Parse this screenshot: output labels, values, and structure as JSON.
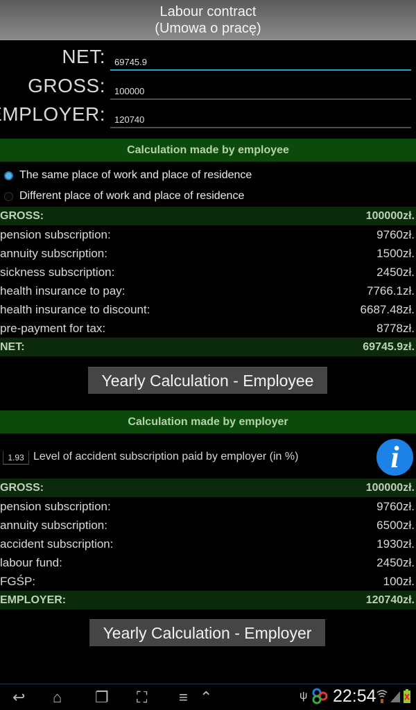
{
  "title": {
    "line1": "Labour contract",
    "line2": "(Umowa o pracę)"
  },
  "fields": {
    "net": {
      "label": "NET:",
      "value": "69745.9"
    },
    "gross": {
      "label": "GROSS:",
      "value": "100000"
    },
    "employer": {
      "label": "EMPLOYER:",
      "value": "120740"
    }
  },
  "employee_section": {
    "header": "Calculation made by employee",
    "radio_options": [
      {
        "label": "The same place of work and place of residence",
        "selected": true
      },
      {
        "label": "Different place of work and place of residence",
        "selected": false
      }
    ],
    "gross": {
      "label": "GROSS:",
      "value": "100000zł."
    },
    "rows": [
      {
        "label": "pension subscription:",
        "value": "9760zł."
      },
      {
        "label": "annuity subscription:",
        "value": "1500zł."
      },
      {
        "label": "sickness subscription:",
        "value": "2450zł."
      },
      {
        "label": "health insurance to pay:",
        "value": "7766.1zł."
      },
      {
        "label": "health insurance to discount:",
        "value": "6687.48zł."
      },
      {
        "label": "pre-payment for tax:",
        "value": "8778zł."
      }
    ],
    "net": {
      "label": "NET:",
      "value": "69745.9zł."
    },
    "yearly_button": "Yearly Calculation - Employee"
  },
  "employer_section": {
    "header": "Calculation made by employer",
    "accident_level_value": "1.93",
    "accident_level_label": "Level of accident subscription paid by employer (in %)",
    "info_icon_glyph": "i",
    "gross": {
      "label": "GROSS:",
      "value": "100000zł."
    },
    "rows": [
      {
        "label": "pension subscription:",
        "value": "9760zł."
      },
      {
        "label": "annuity subscription:",
        "value": "6500zł."
      },
      {
        "label": "accident subscription:",
        "value": "1930zł."
      },
      {
        "label": "labour fund:",
        "value": "2450zł."
      },
      {
        "label": "FGŚP:",
        "value": "100zł."
      }
    ],
    "total": {
      "label": "EMPLOYER:",
      "value": "120740zł."
    },
    "yearly_button": "Yearly Calculation - Employer"
  },
  "system_bar": {
    "nav_icons": {
      "back": "↩",
      "home": "⌂",
      "recents": "❐",
      "screenshot": "⛶",
      "menu": "≡",
      "up": "⌃"
    },
    "time": "22:54",
    "status_icons": [
      "usb-icon",
      "app-icon",
      "wifi-icon",
      "signal-icon",
      "battery-icon"
    ]
  },
  "colors": {
    "section_header_bg": "#0c4a0c",
    "total_row_bg": "#0b2a0b",
    "focus_accent": "#33a0c8",
    "info_icon": "#1c82e6"
  }
}
